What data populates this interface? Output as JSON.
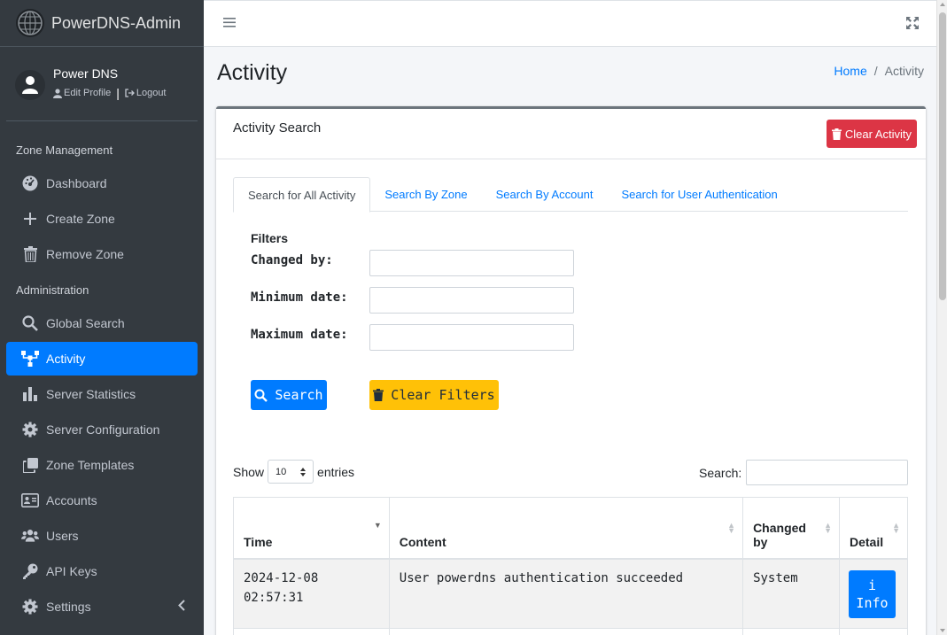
{
  "brand": {
    "name": "PowerDNS-Admin"
  },
  "user": {
    "name": "Power DNS",
    "edit_profile": "Edit Profile",
    "logout": "Logout"
  },
  "nav": {
    "section_zone": "Zone Management",
    "section_admin": "Administration",
    "items": [
      {
        "label": "Dashboard",
        "icon": "dashboard-icon"
      },
      {
        "label": "Create Zone",
        "icon": "plus-icon"
      },
      {
        "label": "Remove Zone",
        "icon": "trash-icon"
      },
      {
        "label": "Global Search",
        "icon": "search-icon"
      },
      {
        "label": "Activity",
        "icon": "sitemap-icon",
        "active": true
      },
      {
        "label": "Server Statistics",
        "icon": "bar-chart-icon"
      },
      {
        "label": "Server Configuration",
        "icon": "gear-icon"
      },
      {
        "label": "Zone Templates",
        "icon": "clone-icon"
      },
      {
        "label": "Accounts",
        "icon": "address-card-icon"
      },
      {
        "label": "Users",
        "icon": "users-icon"
      },
      {
        "label": "API Keys",
        "icon": "key-icon"
      },
      {
        "label": "Settings",
        "icon": "gear-icon"
      }
    ]
  },
  "page": {
    "title": "Activity"
  },
  "breadcrumb": {
    "home": "Home",
    "current": "Activity"
  },
  "card": {
    "title": "Activity Search",
    "clear_activity": "Clear Activity"
  },
  "tabs": [
    "Search for All Activity",
    "Search By Zone",
    "Search By Account",
    "Search for User Authentication"
  ],
  "filters": {
    "title": "Filters",
    "changed_by": "Changed by:",
    "min_date": "Minimum date:",
    "max_date": "Maximum date:",
    "search_btn": "Search",
    "clear_btn": "Clear Filters"
  },
  "table_controls": {
    "show": "Show",
    "entries_value": "10",
    "entries": "entries",
    "search_label": "Search:"
  },
  "table": {
    "headers": {
      "time": "Time",
      "content": "Content",
      "changed_by_1": "Changed",
      "changed_by_2": "by",
      "detail": "Detail"
    },
    "rows": [
      {
        "time_date": "2024-12-08",
        "time_clock": "02:57:31",
        "content": "User powerdns authentication succeeded",
        "changed_by": "System",
        "detail_icon": "i",
        "detail_label": "Info"
      }
    ]
  },
  "colors": {
    "sidebar": "#343a40",
    "active": "#007bff",
    "danger": "#dc3545",
    "warning": "#ffc107"
  }
}
